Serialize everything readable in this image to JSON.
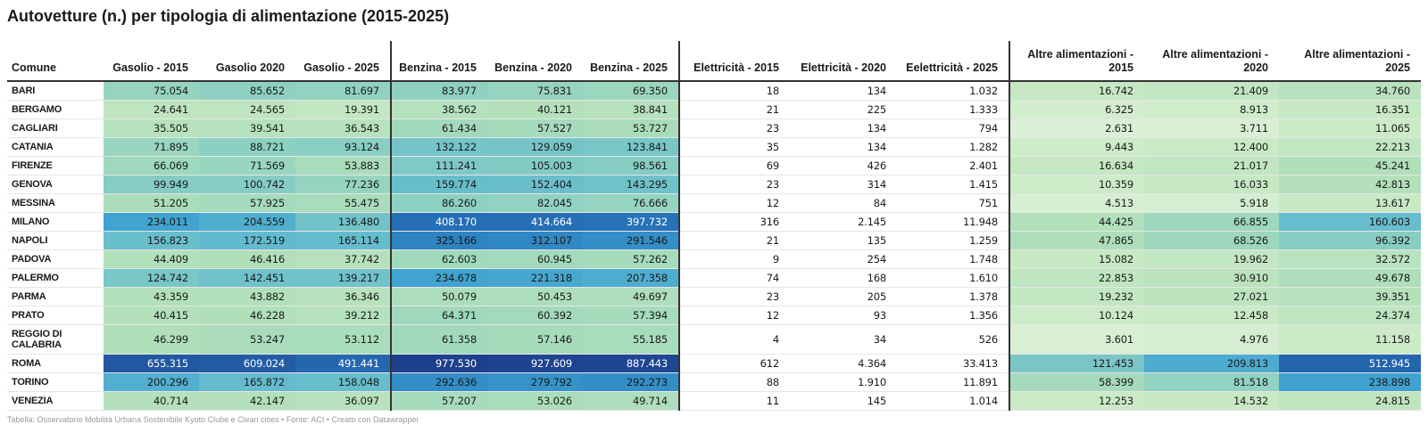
{
  "title": "Autovetture (n.) per tipologia di alimentazione (2015-2025)",
  "footer": "Tabella: Osservatorio Mobilità Urbana Sostenibile Kyoto Clube e Clean cities • Fonte: ACI • Creato con Datawrapper",
  "chart_data": {
    "type": "table",
    "title": "Autovetture (n.) per tipologia di alimentazione (2015-2025)",
    "columns": [
      "Comune",
      "Gasolio - 2015",
      "Gasolio 2020",
      "Gasolio - 2025",
      "Benzina - 2015",
      "Benzina - 2020",
      "Benzina - 2025",
      "Elettricità - 2015",
      "Elettricità - 2020",
      "Eelettricità - 2025",
      "Altre alimentazioni - 2015",
      "Altre alimentazioni - 2020",
      "Altre alimentazioni - 2025"
    ],
    "rows": [
      {
        "comune": "BARI",
        "values": [
          "75.054",
          "85.652",
          "81.697",
          "83.977",
          "75.831",
          "69.350",
          "18",
          "134",
          "1.032",
          "16.742",
          "21.409",
          "34.760"
        ]
      },
      {
        "comune": "BERGAMO",
        "values": [
          "24.641",
          "24.565",
          "19.391",
          "38.562",
          "40.121",
          "38.841",
          "21",
          "225",
          "1.333",
          "6.325",
          "8.913",
          "16.351"
        ]
      },
      {
        "comune": "CAGLIARI",
        "values": [
          "35.505",
          "39.541",
          "36.543",
          "61.434",
          "57.527",
          "53.727",
          "23",
          "134",
          "794",
          "2.631",
          "3.711",
          "11.065"
        ]
      },
      {
        "comune": "CATANIA",
        "values": [
          "71.895",
          "88.721",
          "93.124",
          "132.122",
          "129.059",
          "123.841",
          "35",
          "134",
          "1.282",
          "9.443",
          "12.400",
          "22.213"
        ]
      },
      {
        "comune": "FIRENZE",
        "values": [
          "66.069",
          "71.569",
          "53.883",
          "111.241",
          "105.003",
          "98.561",
          "69",
          "426",
          "2.401",
          "16.634",
          "21.017",
          "45.241"
        ]
      },
      {
        "comune": "GENOVA",
        "values": [
          "99.949",
          "100.742",
          "77.236",
          "159.774",
          "152.404",
          "143.295",
          "23",
          "314",
          "1.415",
          "10.359",
          "16.033",
          "42.813"
        ]
      },
      {
        "comune": "MESSINA",
        "values": [
          "51.205",
          "57.925",
          "55.475",
          "86.260",
          "82.045",
          "76.666",
          "12",
          "84",
          "751",
          "4.513",
          "5.918",
          "13.617"
        ]
      },
      {
        "comune": "MILANO",
        "values": [
          "234.011",
          "204.559",
          "136.480",
          "408.170",
          "414.664",
          "397.732",
          "316",
          "2.145",
          "11.948",
          "44.425",
          "66.855",
          "160.603"
        ]
      },
      {
        "comune": "NAPOLI",
        "values": [
          "156.823",
          "172.519",
          "165.114",
          "325.166",
          "312.107",
          "291.546",
          "21",
          "135",
          "1.259",
          "47.865",
          "68.526",
          "96.392"
        ]
      },
      {
        "comune": "PADOVA",
        "values": [
          "44.409",
          "46.416",
          "37.742",
          "62.603",
          "60.945",
          "57.262",
          "9",
          "254",
          "1.748",
          "15.082",
          "19.962",
          "32.572"
        ]
      },
      {
        "comune": "PALERMO",
        "values": [
          "124.742",
          "142.451",
          "139.217",
          "234.678",
          "221.318",
          "207.358",
          "74",
          "168",
          "1.610",
          "22.853",
          "30.910",
          "49.678"
        ]
      },
      {
        "comune": "PARMA",
        "values": [
          "43.359",
          "43.882",
          "36.346",
          "50.079",
          "50.453",
          "49.697",
          "23",
          "205",
          "1.378",
          "19.232",
          "27.021",
          "39.351"
        ]
      },
      {
        "comune": "PRATO",
        "values": [
          "40.415",
          "46.228",
          "39.212",
          "64.371",
          "60.392",
          "57.394",
          "12",
          "93",
          "1.356",
          "10.124",
          "12.458",
          "24.374"
        ]
      },
      {
        "comune": "REGGIO DI CALABRIA",
        "values": [
          "46.299",
          "53.247",
          "53.112",
          "61.358",
          "57.146",
          "55.185",
          "4",
          "34",
          "526",
          "3.601",
          "4.976",
          "11.158"
        ]
      },
      {
        "comune": "ROMA",
        "values": [
          "655.315",
          "609.024",
          "491.441",
          "977.530",
          "927.609",
          "887.443",
          "612",
          "4.364",
          "33.413",
          "121.453",
          "209.813",
          "512.945"
        ]
      },
      {
        "comune": "TORINO",
        "values": [
          "200.296",
          "165.872",
          "158.048",
          "292.636",
          "279.792",
          "292.273",
          "88",
          "1.910",
          "11.891",
          "58.399",
          "81.518",
          "238.898"
        ]
      },
      {
        "comune": "VENEZIA",
        "values": [
          "40.714",
          "42.147",
          "36.097",
          "57.207",
          "53.026",
          "49.714",
          "11",
          "145",
          "1.014",
          "12.253",
          "14.532",
          "24.815"
        ]
      }
    ]
  }
}
